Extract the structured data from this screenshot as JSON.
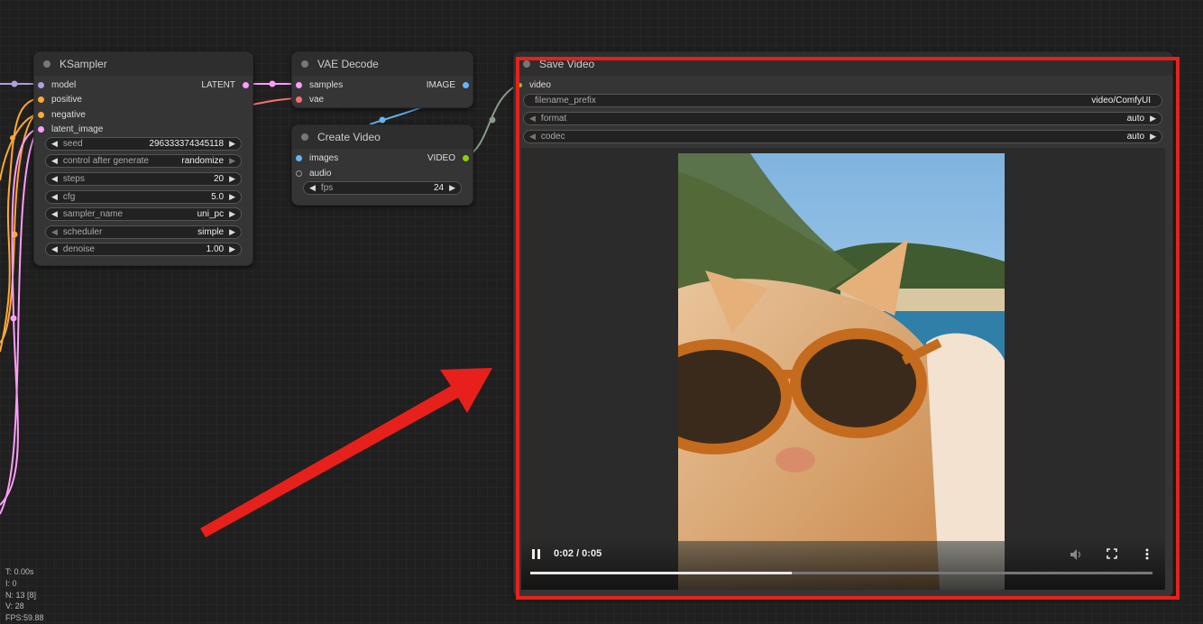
{
  "nodes": {
    "ksampler": {
      "title": "KSampler",
      "inputs": [
        "model",
        "positive",
        "negative",
        "latent_image"
      ],
      "output": "LATENT",
      "widgets": [
        {
          "label": "seed",
          "value": "296333374345118"
        },
        {
          "label": "control after generate",
          "value": "randomize"
        },
        {
          "label": "steps",
          "value": "20"
        },
        {
          "label": "cfg",
          "value": "5.0"
        },
        {
          "label": "sampler_name",
          "value": "uni_pc"
        },
        {
          "label": "scheduler",
          "value": "simple"
        },
        {
          "label": "denoise",
          "value": "1.00"
        }
      ]
    },
    "vae_decode": {
      "title": "VAE Decode",
      "inputs": [
        "samples",
        "vae"
      ],
      "output": "IMAGE"
    },
    "create_video": {
      "title": "Create Video",
      "inputs": [
        "images",
        "audio"
      ],
      "output": "VIDEO",
      "widgets": [
        {
          "label": "fps",
          "value": "24"
        }
      ]
    },
    "save_video": {
      "title": "Save Video",
      "input": "video",
      "widgets": [
        {
          "label": "filename_prefix",
          "value": "video/ComfyUI"
        },
        {
          "label": "format",
          "value": "auto"
        },
        {
          "label": "codec",
          "value": "auto"
        }
      ],
      "player": {
        "time": "0:02 / 0:05",
        "progress": 0.42
      }
    }
  },
  "stats": {
    "t": "T: 0.00s",
    "i": "I: 0",
    "n": "N: 13 [8]",
    "v": "V: 28",
    "fps": "FPS:59.88"
  },
  "colors": {
    "model": "#b39ddb",
    "conditioning": "#ffa931",
    "latent": "#ff9cf9",
    "vae": "#ff6e6e",
    "image": "#64b5f6",
    "video": "#8fce00",
    "highlight": "#e8201b"
  },
  "icons": [
    "pause-icon",
    "volume-icon",
    "fullscreen-icon",
    "more-vert-icon",
    "red-arrow"
  ]
}
